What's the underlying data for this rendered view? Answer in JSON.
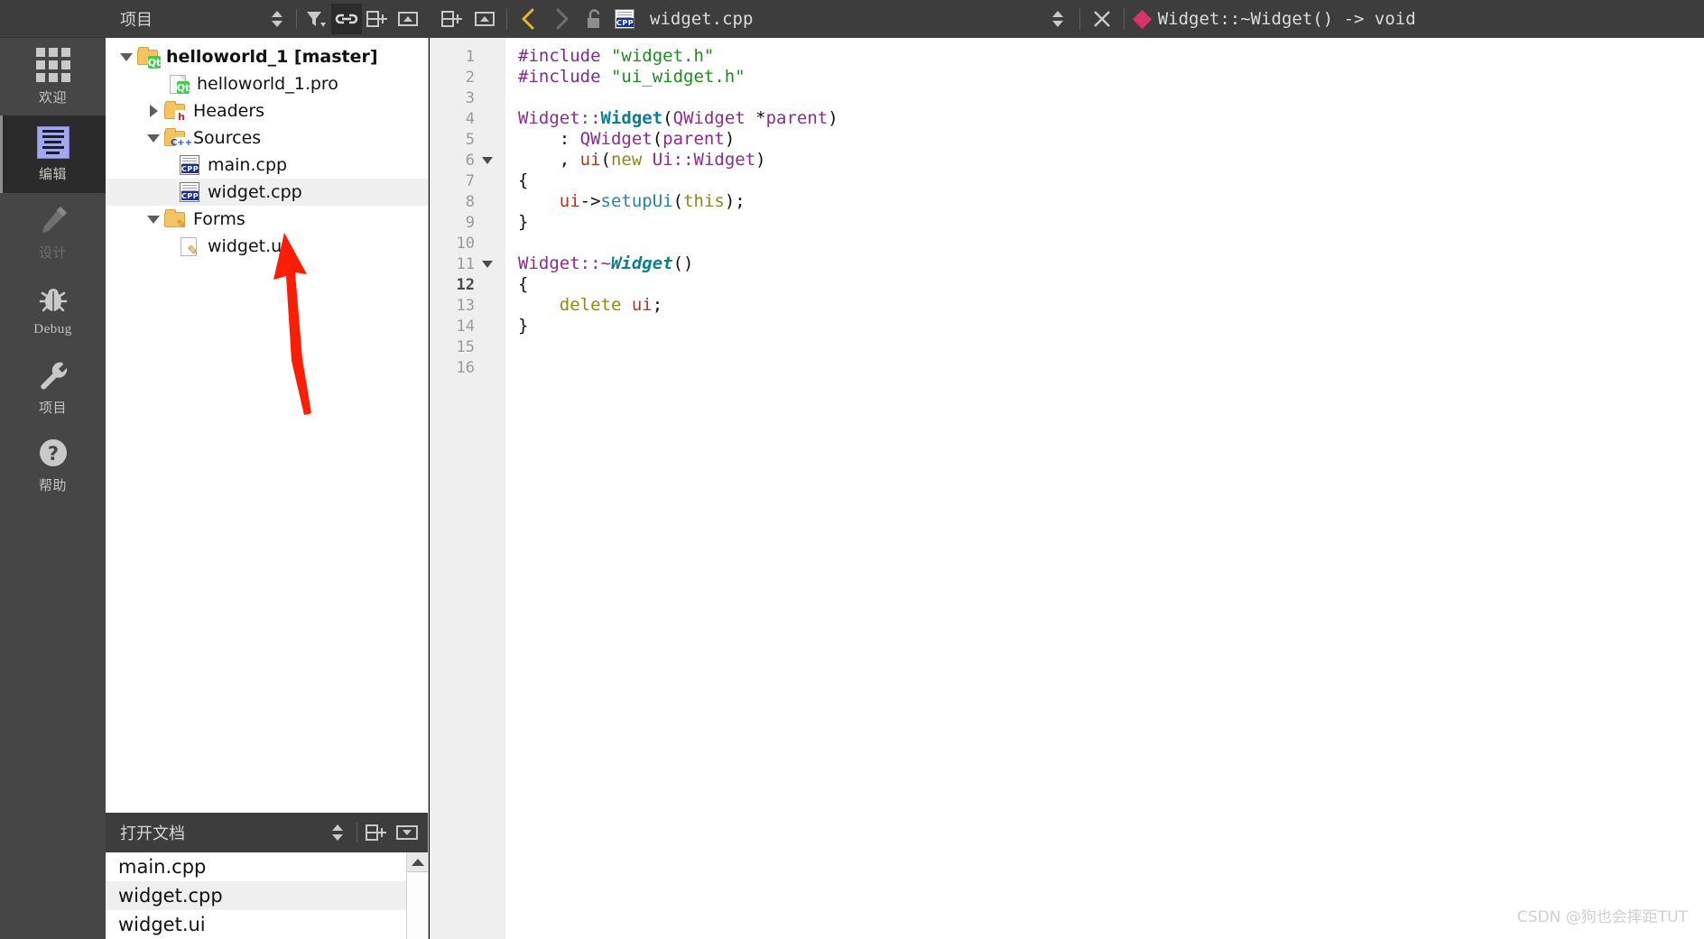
{
  "modebar": {
    "items": [
      {
        "label": "欢迎",
        "icon": "grid-icon",
        "state": "normal"
      },
      {
        "label": "编辑",
        "icon": "edit-document-icon",
        "state": "selected"
      },
      {
        "label": "设计",
        "icon": "pencil-icon",
        "state": "disabled"
      },
      {
        "label": "Debug",
        "icon": "bug-icon",
        "state": "normal"
      },
      {
        "label": "项目",
        "icon": "wrench-icon",
        "state": "normal"
      },
      {
        "label": "帮助",
        "icon": "question-mark-icon",
        "state": "normal"
      }
    ]
  },
  "project_panel": {
    "title": "项目",
    "buttons": [
      {
        "name": "synchronize-selector",
        "icon": "up-down-arrows-icon"
      },
      {
        "name": "filter-tree",
        "icon": "filter-icon"
      },
      {
        "name": "link-with-editor",
        "icon": "link-icon",
        "active": true
      },
      {
        "name": "split-view",
        "icon": "split-plus-icon"
      },
      {
        "name": "close-sidebar",
        "icon": "collapse-icon"
      }
    ],
    "tree": [
      {
        "label": "helloworld_1 [master]",
        "indent": 0,
        "twist": "down",
        "icon": "folder-qt-icon",
        "bold": true,
        "selected": false
      },
      {
        "label": "helloworld_1.pro",
        "indent": 1,
        "twist": "none",
        "icon": "file-pro-icon",
        "bold": false,
        "selected": false
      },
      {
        "label": "Headers",
        "indent": 1,
        "twist": "right",
        "icon": "folder-h-icon",
        "bold": false,
        "selected": false
      },
      {
        "label": "Sources",
        "indent": 1,
        "twist": "down",
        "icon": "folder-cpp-icon",
        "bold": false,
        "selected": false
      },
      {
        "label": "main.cpp",
        "indent": 2,
        "twist": "none",
        "icon": "file-cpp-icon",
        "bold": false,
        "selected": false
      },
      {
        "label": "widget.cpp",
        "indent": 2,
        "twist": "none",
        "icon": "file-cpp-icon",
        "bold": false,
        "selected": true
      },
      {
        "label": "Forms",
        "indent": 1,
        "twist": "down",
        "icon": "folder-ui-icon",
        "bold": false,
        "selected": false
      },
      {
        "label": "widget.ui",
        "indent": 2,
        "twist": "none",
        "icon": "file-ui-icon",
        "bold": false,
        "selected": false
      }
    ]
  },
  "open_documents": {
    "title": "打开文档",
    "buttons": [
      {
        "name": "sort-documents",
        "icon": "up-down-arrows-icon"
      },
      {
        "name": "split-view",
        "icon": "split-plus-icon"
      },
      {
        "name": "close-panel",
        "icon": "dropdown-box-icon"
      }
    ],
    "items": [
      {
        "label": "main.cpp",
        "selected": false
      },
      {
        "label": "widget.cpp",
        "selected": true
      },
      {
        "label": "widget.ui",
        "selected": false
      }
    ]
  },
  "editor_toolbar": {
    "buttons": [
      {
        "name": "split-editor",
        "icon": "split-plus-icon"
      },
      {
        "name": "close-split",
        "icon": "collapse-icon"
      },
      {
        "name": "go-back",
        "icon": "chevron-left-icon",
        "state": "enabled"
      },
      {
        "name": "go-forward",
        "icon": "chevron-right-icon",
        "state": "disabled"
      },
      {
        "name": "make-writable",
        "icon": "unlock-icon"
      }
    ],
    "file_icon": "file-cpp-icon",
    "filename": "widget.cpp",
    "filename_selector_icon": "up-down-arrows-icon",
    "close_icon": "close-x-icon",
    "symbol_icon": "function-diamond-icon",
    "symbol": "Widget::~Widget() -> void"
  },
  "editor": {
    "current_line": 12,
    "lines": [
      {
        "n": 1,
        "fold": false,
        "tokens": [
          {
            "t": "#include ",
            "c": "k-pre"
          },
          {
            "t": "\"widget.h\"",
            "c": "k-str"
          }
        ]
      },
      {
        "n": 2,
        "fold": false,
        "tokens": [
          {
            "t": "#include ",
            "c": "k-pre"
          },
          {
            "t": "\"ui_widget.h\"",
            "c": "k-str"
          }
        ]
      },
      {
        "n": 3,
        "fold": false,
        "tokens": []
      },
      {
        "n": 4,
        "fold": false,
        "tokens": [
          {
            "t": "Widget",
            "c": "k-type"
          },
          {
            "t": "::",
            "c": "k-type"
          },
          {
            "t": "Widget",
            "c": "k-fn"
          },
          {
            "t": "(",
            "c": "k-op"
          },
          {
            "t": "QWidget",
            "c": "k-type"
          },
          {
            "t": " *",
            "c": "k-op"
          },
          {
            "t": "parent",
            "c": "k-type"
          },
          {
            "t": ")",
            "c": "k-op"
          }
        ]
      },
      {
        "n": 5,
        "fold": false,
        "tokens": [
          {
            "t": "    : ",
            "c": "k-op"
          },
          {
            "t": "QWidget",
            "c": "k-type"
          },
          {
            "t": "(",
            "c": "k-op"
          },
          {
            "t": "parent",
            "c": "k-type"
          },
          {
            "t": ")",
            "c": "k-op"
          }
        ]
      },
      {
        "n": 6,
        "fold": true,
        "tokens": [
          {
            "t": "    , ",
            "c": "k-op"
          },
          {
            "t": "ui",
            "c": "k-var"
          },
          {
            "t": "(",
            "c": "k-op"
          },
          {
            "t": "new",
            "c": "k-kw"
          },
          {
            "t": " ",
            "c": "k-op"
          },
          {
            "t": "Ui::Widget",
            "c": "k-type"
          },
          {
            "t": ")",
            "c": "k-op"
          }
        ]
      },
      {
        "n": 7,
        "fold": false,
        "tokens": [
          {
            "t": "{",
            "c": "k-plain"
          }
        ]
      },
      {
        "n": 8,
        "fold": false,
        "tokens": [
          {
            "t": "    ",
            "c": "k-op"
          },
          {
            "t": "ui",
            "c": "k-var"
          },
          {
            "t": "->",
            "c": "k-op"
          },
          {
            "t": "setupUi",
            "c": "k-call"
          },
          {
            "t": "(",
            "c": "k-op"
          },
          {
            "t": "this",
            "c": "k-this"
          },
          {
            "t": ");",
            "c": "k-op"
          }
        ]
      },
      {
        "n": 9,
        "fold": false,
        "tokens": [
          {
            "t": "}",
            "c": "k-plain"
          }
        ]
      },
      {
        "n": 10,
        "fold": false,
        "tokens": []
      },
      {
        "n": 11,
        "fold": true,
        "tokens": [
          {
            "t": "Widget",
            "c": "k-type"
          },
          {
            "t": "::~",
            "c": "k-type"
          },
          {
            "t": "Widget",
            "c": "k-fn-i"
          },
          {
            "t": "()",
            "c": "k-op"
          }
        ]
      },
      {
        "n": 12,
        "fold": false,
        "tokens": [
          {
            "t": "{",
            "c": "k-plain"
          }
        ]
      },
      {
        "n": 13,
        "fold": false,
        "tokens": [
          {
            "t": "    ",
            "c": "k-op"
          },
          {
            "t": "delete",
            "c": "k-kw"
          },
          {
            "t": " ",
            "c": "k-op"
          },
          {
            "t": "ui",
            "c": "k-var"
          },
          {
            "t": ";",
            "c": "k-op"
          }
        ]
      },
      {
        "n": 14,
        "fold": false,
        "tokens": [
          {
            "t": "}",
            "c": "k-plain"
          }
        ]
      },
      {
        "n": 15,
        "fold": false,
        "tokens": []
      },
      {
        "n": 16,
        "fold": false,
        "tokens": []
      }
    ]
  },
  "annotation": {
    "arrow_color": "#fc1d05",
    "points_at": "widget.ui"
  },
  "watermark": "CSDN @狗也会摔距TUT",
  "colors": {
    "chrome": "#3d3d3d",
    "modebar": "#464646",
    "selected_mode": "#2b2b2b",
    "selection": "#f0f0f0",
    "accent_pink": "#d6336c",
    "gutter": "#efefef"
  }
}
